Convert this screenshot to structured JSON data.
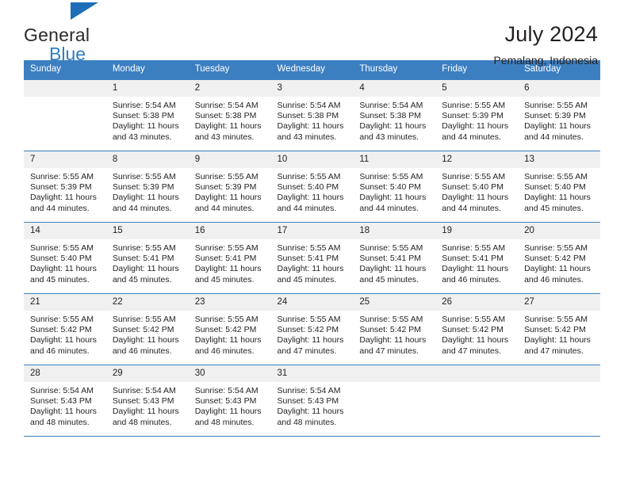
{
  "brand": {
    "line1": "General",
    "line2": "Blue",
    "flag_icon": "brand-flag-icon",
    "colors": {
      "blue": "#2e7cc4",
      "flag": "#1d6fb8",
      "dark": "#2a2a2a"
    }
  },
  "header": {
    "title": "July 2024",
    "subtitle": "Pemalang, Indonesia"
  },
  "theme": {
    "header_bg": "#3c7fc1",
    "header_text": "#ffffff",
    "daynum_bg": "#f0f0f0",
    "grid_line": "#3c7fc1",
    "text": "#231f20"
  },
  "columns": [
    "Sunday",
    "Monday",
    "Tuesday",
    "Wednesday",
    "Thursday",
    "Friday",
    "Saturday"
  ],
  "weeks": [
    [
      {
        "day": "",
        "lines": []
      },
      {
        "day": "1",
        "lines": [
          "Sunrise: 5:54 AM",
          "Sunset: 5:38 PM",
          "Daylight: 11 hours",
          "and 43 minutes."
        ]
      },
      {
        "day": "2",
        "lines": [
          "Sunrise: 5:54 AM",
          "Sunset: 5:38 PM",
          "Daylight: 11 hours",
          "and 43 minutes."
        ]
      },
      {
        "day": "3",
        "lines": [
          "Sunrise: 5:54 AM",
          "Sunset: 5:38 PM",
          "Daylight: 11 hours",
          "and 43 minutes."
        ]
      },
      {
        "day": "4",
        "lines": [
          "Sunrise: 5:54 AM",
          "Sunset: 5:38 PM",
          "Daylight: 11 hours",
          "and 43 minutes."
        ]
      },
      {
        "day": "5",
        "lines": [
          "Sunrise: 5:55 AM",
          "Sunset: 5:39 PM",
          "Daylight: 11 hours",
          "and 44 minutes."
        ]
      },
      {
        "day": "6",
        "lines": [
          "Sunrise: 5:55 AM",
          "Sunset: 5:39 PM",
          "Daylight: 11 hours",
          "and 44 minutes."
        ]
      }
    ],
    [
      {
        "day": "7",
        "lines": [
          "Sunrise: 5:55 AM",
          "Sunset: 5:39 PM",
          "Daylight: 11 hours",
          "and 44 minutes."
        ]
      },
      {
        "day": "8",
        "lines": [
          "Sunrise: 5:55 AM",
          "Sunset: 5:39 PM",
          "Daylight: 11 hours",
          "and 44 minutes."
        ]
      },
      {
        "day": "9",
        "lines": [
          "Sunrise: 5:55 AM",
          "Sunset: 5:39 PM",
          "Daylight: 11 hours",
          "and 44 minutes."
        ]
      },
      {
        "day": "10",
        "lines": [
          "Sunrise: 5:55 AM",
          "Sunset: 5:40 PM",
          "Daylight: 11 hours",
          "and 44 minutes."
        ]
      },
      {
        "day": "11",
        "lines": [
          "Sunrise: 5:55 AM",
          "Sunset: 5:40 PM",
          "Daylight: 11 hours",
          "and 44 minutes."
        ]
      },
      {
        "day": "12",
        "lines": [
          "Sunrise: 5:55 AM",
          "Sunset: 5:40 PM",
          "Daylight: 11 hours",
          "and 44 minutes."
        ]
      },
      {
        "day": "13",
        "lines": [
          "Sunrise: 5:55 AM",
          "Sunset: 5:40 PM",
          "Daylight: 11 hours",
          "and 45 minutes."
        ]
      }
    ],
    [
      {
        "day": "14",
        "lines": [
          "Sunrise: 5:55 AM",
          "Sunset: 5:40 PM",
          "Daylight: 11 hours",
          "and 45 minutes."
        ]
      },
      {
        "day": "15",
        "lines": [
          "Sunrise: 5:55 AM",
          "Sunset: 5:41 PM",
          "Daylight: 11 hours",
          "and 45 minutes."
        ]
      },
      {
        "day": "16",
        "lines": [
          "Sunrise: 5:55 AM",
          "Sunset: 5:41 PM",
          "Daylight: 11 hours",
          "and 45 minutes."
        ]
      },
      {
        "day": "17",
        "lines": [
          "Sunrise: 5:55 AM",
          "Sunset: 5:41 PM",
          "Daylight: 11 hours",
          "and 45 minutes."
        ]
      },
      {
        "day": "18",
        "lines": [
          "Sunrise: 5:55 AM",
          "Sunset: 5:41 PM",
          "Daylight: 11 hours",
          "and 45 minutes."
        ]
      },
      {
        "day": "19",
        "lines": [
          "Sunrise: 5:55 AM",
          "Sunset: 5:41 PM",
          "Daylight: 11 hours",
          "and 46 minutes."
        ]
      },
      {
        "day": "20",
        "lines": [
          "Sunrise: 5:55 AM",
          "Sunset: 5:42 PM",
          "Daylight: 11 hours",
          "and 46 minutes."
        ]
      }
    ],
    [
      {
        "day": "21",
        "lines": [
          "Sunrise: 5:55 AM",
          "Sunset: 5:42 PM",
          "Daylight: 11 hours",
          "and 46 minutes."
        ]
      },
      {
        "day": "22",
        "lines": [
          "Sunrise: 5:55 AM",
          "Sunset: 5:42 PM",
          "Daylight: 11 hours",
          "and 46 minutes."
        ]
      },
      {
        "day": "23",
        "lines": [
          "Sunrise: 5:55 AM",
          "Sunset: 5:42 PM",
          "Daylight: 11 hours",
          "and 46 minutes."
        ]
      },
      {
        "day": "24",
        "lines": [
          "Sunrise: 5:55 AM",
          "Sunset: 5:42 PM",
          "Daylight: 11 hours",
          "and 47 minutes."
        ]
      },
      {
        "day": "25",
        "lines": [
          "Sunrise: 5:55 AM",
          "Sunset: 5:42 PM",
          "Daylight: 11 hours",
          "and 47 minutes."
        ]
      },
      {
        "day": "26",
        "lines": [
          "Sunrise: 5:55 AM",
          "Sunset: 5:42 PM",
          "Daylight: 11 hours",
          "and 47 minutes."
        ]
      },
      {
        "day": "27",
        "lines": [
          "Sunrise: 5:55 AM",
          "Sunset: 5:42 PM",
          "Daylight: 11 hours",
          "and 47 minutes."
        ]
      }
    ],
    [
      {
        "day": "28",
        "lines": [
          "Sunrise: 5:54 AM",
          "Sunset: 5:43 PM",
          "Daylight: 11 hours",
          "and 48 minutes."
        ]
      },
      {
        "day": "29",
        "lines": [
          "Sunrise: 5:54 AM",
          "Sunset: 5:43 PM",
          "Daylight: 11 hours",
          "and 48 minutes."
        ]
      },
      {
        "day": "30",
        "lines": [
          "Sunrise: 5:54 AM",
          "Sunset: 5:43 PM",
          "Daylight: 11 hours",
          "and 48 minutes."
        ]
      },
      {
        "day": "31",
        "lines": [
          "Sunrise: 5:54 AM",
          "Sunset: 5:43 PM",
          "Daylight: 11 hours",
          "and 48 minutes."
        ]
      },
      {
        "day": "",
        "lines": []
      },
      {
        "day": "",
        "lines": []
      },
      {
        "day": "",
        "lines": []
      }
    ]
  ]
}
